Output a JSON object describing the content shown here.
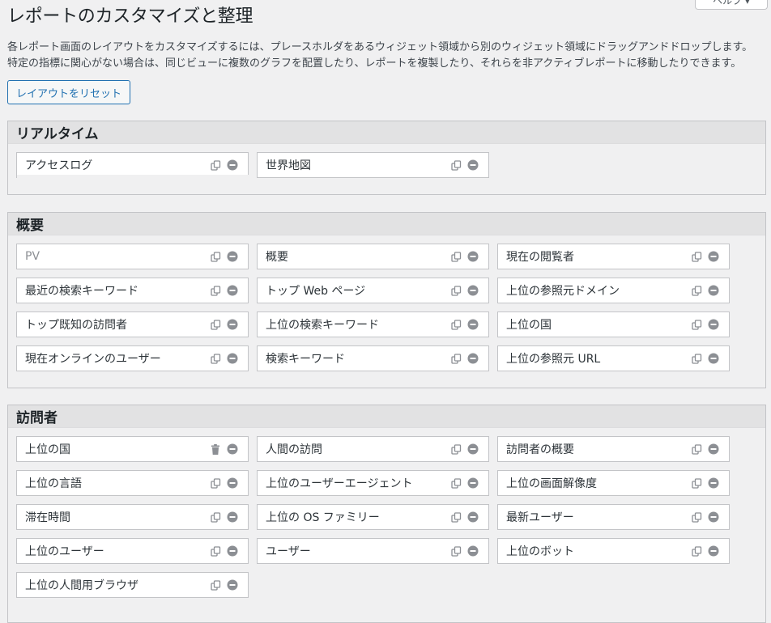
{
  "page": {
    "title": "レポートのカスタマイズと整理",
    "help_label": "ヘルプ ▾",
    "description_line1": "各レポート画面のレイアウトをカスタマイズするには、プレースホルダをあるウィジェット領域から別のウィジェット領域にドラッグアンドドロップします。",
    "description_line2": "特定の指標に関心がない場合は、同じビューに複数のグラフを配置したり、レポートを複製したり、それらを非アクティブレポートに移動したりできます。",
    "reset_label": "レイアウトをリセット"
  },
  "icons": {
    "duplicate": "duplicate-icon",
    "remove": "remove-icon",
    "trash": "trash-icon"
  },
  "colors": {
    "accent": "#2271b1",
    "icon": "#8c8f94",
    "header_bg": "#e2e2e3"
  },
  "sections": [
    {
      "title": "リアルタイム",
      "widgets": [
        {
          "label": "アクセスログ"
        },
        {
          "label": "世界地図"
        }
      ]
    },
    {
      "title": "概要",
      "widgets": [
        {
          "label": "PV"
        },
        {
          "label": "概要"
        },
        {
          "label": "現在の閲覧者"
        },
        {
          "label": "最近の検索キーワード"
        },
        {
          "label": "トップ Web ページ"
        },
        {
          "label": "上位の参照元ドメイン"
        },
        {
          "label": "トップ既知の訪問者"
        },
        {
          "label": "上位の検索キーワード"
        },
        {
          "label": "上位の国"
        },
        {
          "label": "現在オンラインのユーザー"
        },
        {
          "label": "検索キーワード"
        },
        {
          "label": "上位の参照元 URL"
        }
      ]
    },
    {
      "title": "訪問者",
      "widgets": [
        {
          "label": "上位の国"
        },
        {
          "label": "人間の訪問"
        },
        {
          "label": "訪問者の概要"
        },
        {
          "label": "上位の言語"
        },
        {
          "label": "上位のユーザーエージェント"
        },
        {
          "label": "上位の画面解像度"
        },
        {
          "label": "滞在時間"
        },
        {
          "label": "上位の OS ファミリー"
        },
        {
          "label": "最新ユーザー"
        },
        {
          "label": "上位のユーザー"
        },
        {
          "label": "ユーザー"
        },
        {
          "label": "上位のボット"
        },
        {
          "label": "上位の人間用ブラウザ"
        }
      ]
    }
  ]
}
